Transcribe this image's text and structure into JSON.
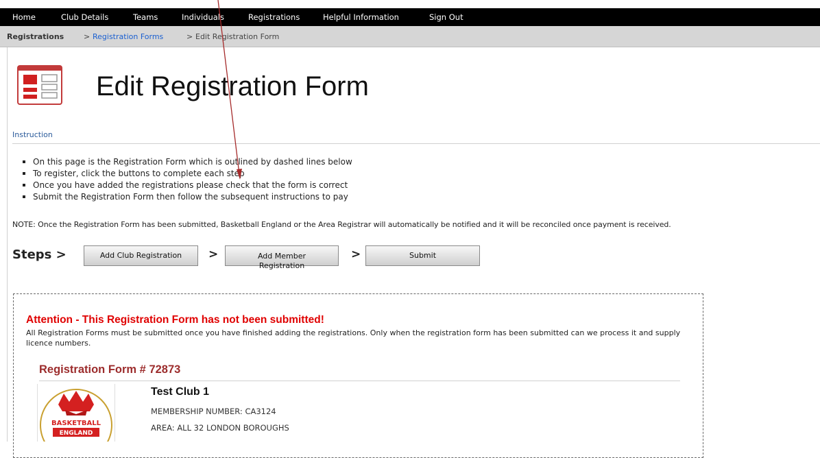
{
  "nav": {
    "items": [
      "Home",
      "Club Details",
      "Teams",
      "Individuals",
      "Registrations",
      "Helpful Information",
      "Sign Out"
    ]
  },
  "breadcrumb": {
    "root": "Registrations",
    "sep1": ">",
    "link": "Registration Forms",
    "sep2": ">",
    "current": "Edit Registration Form"
  },
  "page": {
    "title": "Edit Registration Form",
    "icon": "registration-form-icon"
  },
  "instruction": {
    "label": "Instruction",
    "bullets": [
      "On this page is the Registration Form which is outlined by dashed lines below",
      "To register, click the buttons to complete each step",
      "Once you have added the registrations please check that the form is correct",
      "Submit the Registration Form then follow the subsequent instructions to pay"
    ],
    "note": "NOTE: Once the Registration Form has been submitted, Basketball England or the Area Registrar will automatically be notified and it will be reconciled once payment is received."
  },
  "steps": {
    "label": "Steps >",
    "separator": ">",
    "buttons": [
      "Add Club Registration",
      "Add Member Registration",
      "Submit"
    ]
  },
  "form": {
    "attention_title": "Attention - This Registration Form has not been submitted!",
    "attention_text": "All Registration Forms must be submitted once you have finished adding the registrations. Only when the registration form has been submitted can we process it and supply licence numbers.",
    "title": "Registration Form # 72873",
    "club_name": "Test Club 1",
    "membership_number": "MEMBERSHIP NUMBER:  CA3124",
    "area": "AREA:  ALL 32 LONDON BOROUGHS",
    "logo_text_1": "BASKETBALL",
    "logo_text_2": "ENGLAND"
  },
  "colors": {
    "navbar_bg": "#000000",
    "breadcrumb_bg": "#d6d6d6",
    "attention": "#e00000",
    "form_title": "#9c2c2c",
    "link": "#1a5fd0",
    "annotation_arrow": "#a52a2a"
  }
}
